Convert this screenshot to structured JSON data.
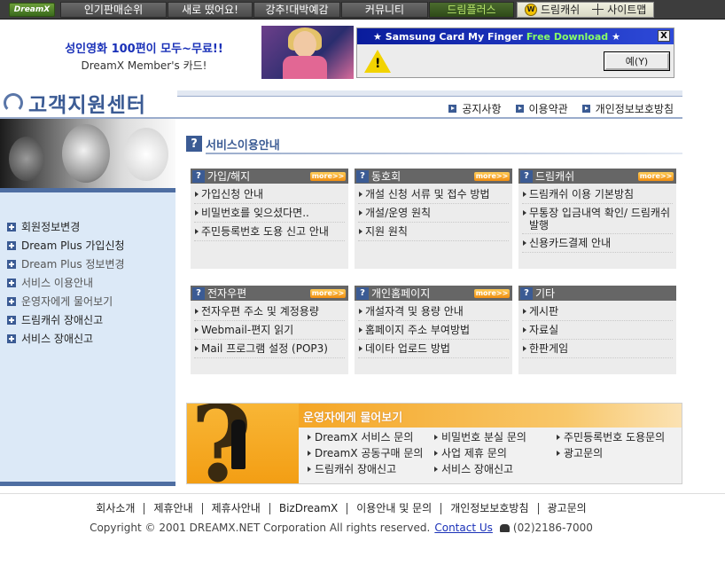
{
  "top_nav": {
    "logo": "DreamX",
    "items": [
      {
        "label": "인기판매순위",
        "width": 88
      },
      {
        "label": "새로 떴어요!",
        "width": 92
      },
      {
        "label": "강추!대박예감",
        "width": 98
      },
      {
        "label": "커뮤니티",
        "width": 98
      },
      {
        "label": "드림플러스",
        "width": 88
      }
    ],
    "right": {
      "cash": "드림캐쉬",
      "sitemap": "사이트맵",
      "cash_icon": "W"
    }
  },
  "promo": {
    "line1": "성인영화 100편이 모두~무료!!",
    "line2": "DreamX Member's 카드!"
  },
  "alert_box": {
    "title_pre": "★ Samsung Card My Finger",
    "title_hl": "Free Download",
    "title_post": "★",
    "close": "X",
    "warn": "!",
    "button": "예(Y)"
  },
  "header": {
    "title": "고객지원센터",
    "links": [
      "공지사항",
      "이용약관",
      "개인정보보호방침"
    ]
  },
  "sidebar": {
    "items": [
      {
        "label": "회원정보변경"
      },
      {
        "label": "Dream Plus 가입신청"
      },
      {
        "label": "Dream Plus 정보변경"
      },
      {
        "label": "서비스 이용안내"
      },
      {
        "label": "운영자에게 물어보기"
      },
      {
        "label": "드림캐쉬 장애신고"
      },
      {
        "label": "서비스 장애신고"
      }
    ]
  },
  "section": {
    "title": "서비스이용안내",
    "more_label": "more>>"
  },
  "categories": [
    {
      "title": "가입/해지",
      "items": [
        "가입신청 안내",
        "비밀번호를 잊으셨다면..",
        "주민등록번호 도용 신고 안내"
      ]
    },
    {
      "title": "동호회",
      "items": [
        "개설 신청 서류 및 접수 방법",
        "개설/운영 원칙",
        "지원 원칙"
      ]
    },
    {
      "title": "드림캐쉬",
      "items": [
        "드림캐쉬 이용 기본방침",
        "무통장 입금내역 확인/ 드림캐쉬 발행",
        "신용카드결제 안내"
      ]
    },
    {
      "title": "전자우편",
      "items": [
        "전자우편 주소 및 계정용량",
        "Webmail-편지 읽기",
        "Mail 프로그램 설정 (POP3)"
      ]
    },
    {
      "title": "개인홈페이지",
      "items": [
        "개설자격 및 용량 안내",
        "홈페이지 주소 부여방법",
        "데이타 업로드 방법"
      ]
    },
    {
      "title": "기타",
      "items": [
        "게시판",
        "자료실",
        "한판게임"
      ]
    }
  ],
  "operator": {
    "title": "운영자에게 물어보기",
    "links": [
      "DreamX 서비스 문의",
      "비밀번호 분실 문의",
      "주민등록번호 도용문의",
      "DreamX 공동구매 문의",
      "사업 제휴 문의",
      "광고문의",
      "드림캐쉬 장애신고",
      "서비스 장애신고"
    ]
  },
  "footer": {
    "links": [
      "회사소개",
      "제휴안내",
      "제휴사안내",
      "BizDreamX",
      "이용안내 및 문의",
      "개인정보보호방침",
      "광고문의"
    ],
    "copyright": "Copyright © 2001 DREAMX.NET Corporation All rights reserved.",
    "contact": "Contact Us",
    "phone": "(02)2186-7000"
  },
  "colors": {
    "accent": "#3b5b94",
    "orange": "#f5a625",
    "sidebar_bg": "#dce9f7",
    "nav_bg": "#3d3d3d"
  }
}
